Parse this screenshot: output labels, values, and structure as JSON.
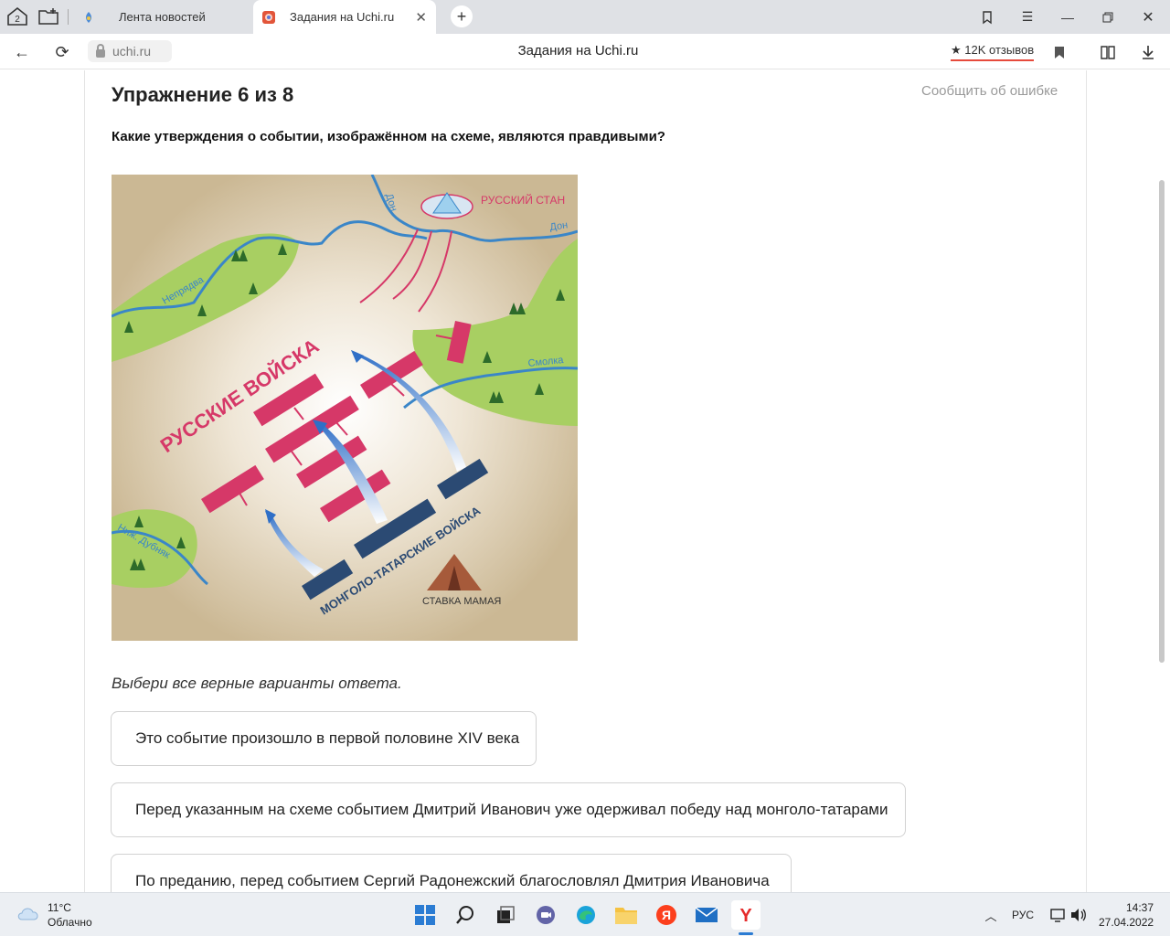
{
  "browser": {
    "tab_count": "2",
    "tabs": [
      {
        "title": "Лента новостей",
        "active": false
      },
      {
        "title": "Задания на Uchi.ru",
        "active": true
      }
    ],
    "url": "uchi.ru",
    "page_title": "Задания на Uchi.ru",
    "reviews": "★ 12K отзывов"
  },
  "exercise": {
    "title": "Упражнение 6 из 8",
    "report_link": "Сообщить об ошибке",
    "question": "Какие утверждения о событии, изображённом на схеме, являются правдивыми?",
    "hint": "Выбери все верные варианты ответа.",
    "options": [
      "Это событие произошло в первой половине XIV века",
      "Перед указанным на схеме событием Дмитрий Иванович уже одерживал победу над монголо-татарами",
      "По преданию, перед событием Сергий Радонежский благословлял Дмитрия Ивановича"
    ]
  },
  "scheme": {
    "labels": {
      "russian_camp": "РУССКИЙ СТАН",
      "don_1": "Дон",
      "don_2": "Дон",
      "nepryadva": "Непрядва",
      "smolka": "Смолка",
      "nizh_dubnyak": "Ниж. Дубняк",
      "russian_troops": "РУССКИЕ ВОЙСКА",
      "mongol_troops": "МОНГОЛО-ТАТАРСКИЕ ВОЙСКА",
      "mamai_hq": "СТАВКА МАМАЯ"
    },
    "colors": {
      "russian": "#d63868",
      "mongol": "#2b4a73",
      "water": "#3a86c8",
      "land": "#cbb894",
      "forest": "#a8cf62"
    }
  },
  "taskbar": {
    "weather_temp": "11°C",
    "weather_desc": "Облачно",
    "lang": "РУС",
    "time": "14:37",
    "date": "27.04.2022"
  }
}
